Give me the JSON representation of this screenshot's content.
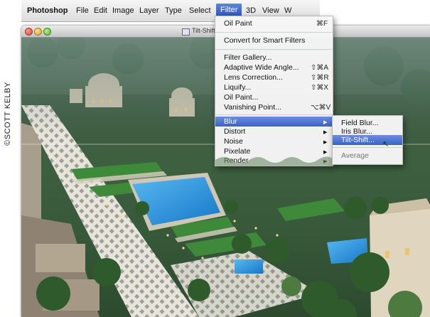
{
  "credit": "©SCOTT KELBY",
  "menubar": {
    "items": [
      "Photoshop",
      "File",
      "Edit",
      "Image",
      "Layer",
      "Type",
      "Select",
      "Filter",
      "3D",
      "View",
      "W"
    ],
    "active": "Filter"
  },
  "window": {
    "title": "Tilt-Shift"
  },
  "filter_menu": {
    "last_filter": {
      "label": "Oil Paint",
      "shortcut": "⌘F"
    },
    "convert": "Convert for Smart Filters",
    "group2": [
      {
        "label": "Filter Gallery...",
        "shortcut": ""
      },
      {
        "label": "Adaptive Wide Angle...",
        "shortcut": "⇧⌘A"
      },
      {
        "label": "Lens Correction...",
        "shortcut": "⇧⌘R"
      },
      {
        "label": "Liquify...",
        "shortcut": "⇧⌘X"
      },
      {
        "label": "Oil Paint...",
        "shortcut": ""
      },
      {
        "label": "Vanishing Point...",
        "shortcut": "⌥⌘V"
      }
    ],
    "group3": [
      "Blur",
      "Distort",
      "Noise",
      "Pixelate",
      "Render"
    ],
    "highlighted": "Blur"
  },
  "blur_submenu": {
    "items": [
      "Field Blur...",
      "Iris Blur...",
      "Tilt-Shift...",
      "Average"
    ],
    "highlighted": "Tilt-Shift..."
  },
  "colors": {
    "highlight": "#3a62c8",
    "pool": "#1f8fd8"
  }
}
